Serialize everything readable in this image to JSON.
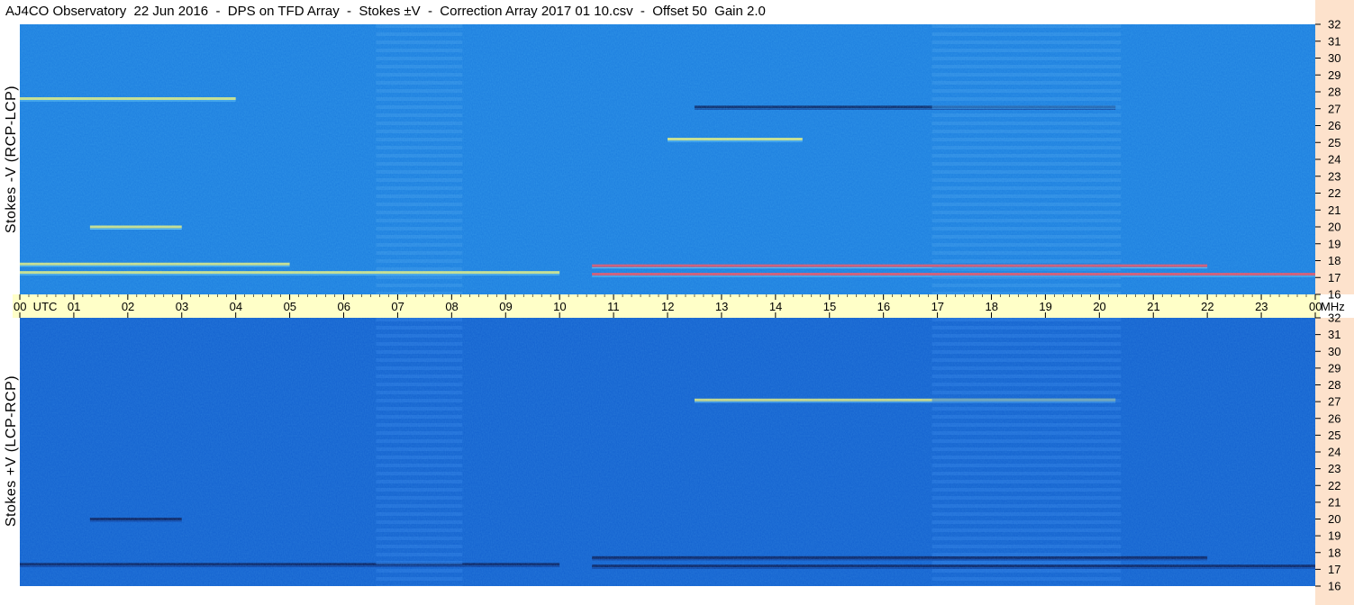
{
  "header": {
    "title": "AJ4CO Observatory  22 Jun 2016  -  DPS on TFD Array  -  Stokes ±V  -  Correction Array 2017 01 10.csv  -  Offset 50  Gain 2.0"
  },
  "colors": {
    "background_top": "#1e7fdf",
    "background_bottom": "#1563d0",
    "time_axis_bg": "#ffffc8",
    "freq_axis_bg": "#fde2cc",
    "rfi_bright": "#f5f57a",
    "rfi_hot": "#ff4f5a",
    "rfi_dark": "#0a1a55"
  },
  "chart_data": [
    {
      "type": "heatmap",
      "name": "Stokes -V (RCP-LCP)",
      "ylabel": "Stokes -V (RCP-LCP)",
      "x_range_utc_hours": [
        0,
        24
      ],
      "y_range_mhz": [
        16,
        32
      ],
      "y_ticks": [
        "16",
        "17",
        "18",
        "19",
        "20",
        "21",
        "22",
        "23",
        "24",
        "25",
        "26",
        "27",
        "28",
        "29",
        "30",
        "31",
        "32"
      ],
      "features": [
        {
          "kind": "rfi_line",
          "freq_mhz": 17.2,
          "t_start": 10.6,
          "t_end": 24,
          "level": "hot"
        },
        {
          "kind": "rfi_line",
          "freq_mhz": 17.7,
          "t_start": 10.6,
          "t_end": 22.0,
          "level": "hot"
        },
        {
          "kind": "rfi_line",
          "freq_mhz": 17.3,
          "t_start": 0,
          "t_end": 10.0,
          "level": "bright"
        },
        {
          "kind": "rfi_line",
          "freq_mhz": 17.8,
          "t_start": 0,
          "t_end": 5.0,
          "level": "bright"
        },
        {
          "kind": "rfi_line",
          "freq_mhz": 27.1,
          "t_start": 12.5,
          "t_end": 20.3,
          "level": "dark"
        },
        {
          "kind": "rfi_line",
          "freq_mhz": 27.6,
          "t_start": 0,
          "t_end": 4.0,
          "level": "bright"
        },
        {
          "kind": "rfi_line",
          "freq_mhz": 20.0,
          "t_start": 1.3,
          "t_end": 3.0,
          "level": "bright"
        },
        {
          "kind": "rfi_line",
          "freq_mhz": 25.2,
          "t_start": 12.0,
          "t_end": 14.5,
          "level": "bright"
        },
        {
          "kind": "band",
          "freq_lo": 16,
          "freq_hi": 32,
          "t_start": 6.6,
          "t_end": 8.2,
          "level": "banded"
        },
        {
          "kind": "band",
          "freq_lo": 16,
          "freq_hi": 32,
          "t_start": 16.9,
          "t_end": 20.4,
          "level": "banded"
        }
      ]
    },
    {
      "type": "heatmap",
      "name": "Stokes +V (LCP-RCP)",
      "ylabel": "Stokes +V (LCP-RCP)",
      "x_range_utc_hours": [
        0,
        24
      ],
      "y_range_mhz": [
        16,
        32
      ],
      "y_ticks": [
        "16",
        "17",
        "18",
        "19",
        "20",
        "21",
        "22",
        "23",
        "24",
        "25",
        "26",
        "27",
        "28",
        "29",
        "30",
        "31",
        "32"
      ],
      "features": [
        {
          "kind": "rfi_line",
          "freq_mhz": 17.2,
          "t_start": 10.6,
          "t_end": 24,
          "level": "dark"
        },
        {
          "kind": "rfi_line",
          "freq_mhz": 17.7,
          "t_start": 10.6,
          "t_end": 22.0,
          "level": "dark"
        },
        {
          "kind": "rfi_line",
          "freq_mhz": 17.3,
          "t_start": 0,
          "t_end": 10.0,
          "level": "dark"
        },
        {
          "kind": "rfi_line",
          "freq_mhz": 27.1,
          "t_start": 12.5,
          "t_end": 20.3,
          "level": "bright"
        },
        {
          "kind": "rfi_line",
          "freq_mhz": 20.0,
          "t_start": 1.3,
          "t_end": 3.0,
          "level": "dark"
        },
        {
          "kind": "band",
          "freq_lo": 16,
          "freq_hi": 32,
          "t_start": 6.6,
          "t_end": 8.2,
          "level": "banded"
        },
        {
          "kind": "band",
          "freq_lo": 16,
          "freq_hi": 32,
          "t_start": 16.9,
          "t_end": 20.4,
          "level": "banded"
        }
      ]
    }
  ],
  "time_axis": {
    "ticks": [
      "00  UTC",
      "01",
      "02",
      "03",
      "04",
      "05",
      "06",
      "07",
      "08",
      "09",
      "10",
      "11",
      "12",
      "13",
      "14",
      "15",
      "16",
      "17",
      "18",
      "19",
      "20",
      "21",
      "22",
      "23",
      "00"
    ],
    "unit": "MHz"
  }
}
